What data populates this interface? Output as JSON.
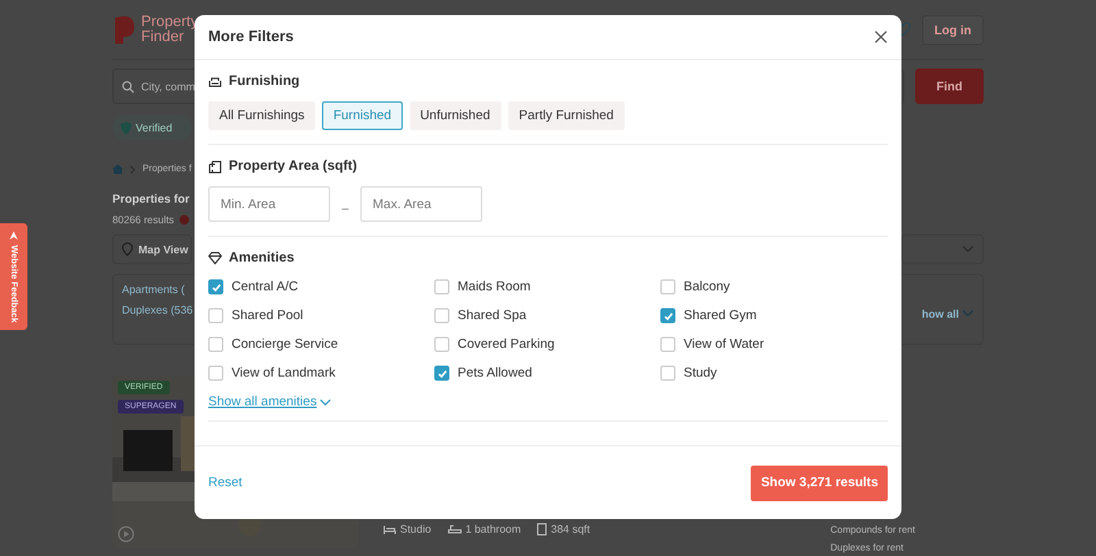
{
  "page": {
    "logo_lines": [
      "Property",
      "Finder"
    ],
    "login": "Log in",
    "search_placeholder": "City, comm",
    "find": "Find",
    "chip": "Verified",
    "breadcrumb": "Properties f",
    "heading": "Properties for",
    "results": "80266 results",
    "map_view": "Map View",
    "links": [
      "Apartments (",
      "Duplexes (536"
    ],
    "show_all": "how all",
    "listing": {
      "badges": [
        {
          "label": "VERIFIED",
          "kind": "verified"
        },
        {
          "label": "SUPERAGEN",
          "kind": "superagent"
        }
      ],
      "facts": [
        {
          "label": "Studio",
          "kind": "bed"
        },
        {
          "label": "1 bathroom",
          "kind": "bath"
        },
        {
          "label": "384 sqft",
          "kind": "area"
        }
      ]
    },
    "side_links": [
      "Compounds for rent",
      "Duplexes for rent"
    ],
    "feedback": "Website Feedback"
  },
  "modal": {
    "title": "More Filters",
    "furnishing": {
      "title": "Furnishing",
      "options": [
        {
          "label": "All Furnishings",
          "selected": false
        },
        {
          "label": "Furnished",
          "selected": true
        },
        {
          "label": "Unfurnished",
          "selected": false
        },
        {
          "label": "Partly Furnished",
          "selected": false
        }
      ]
    },
    "area": {
      "title": "Property Area (sqft)",
      "min_placeholder": "Min. Area",
      "separator": "–",
      "max_placeholder": "Max. Area"
    },
    "amenities": {
      "title": "Amenities",
      "items": [
        {
          "label": "Central A/C",
          "checked": true
        },
        {
          "label": "Maids Room",
          "checked": false
        },
        {
          "label": "Balcony",
          "checked": false
        },
        {
          "label": "Shared Pool",
          "checked": false
        },
        {
          "label": "Shared Spa",
          "checked": false
        },
        {
          "label": "Shared Gym",
          "checked": true
        },
        {
          "label": "Concierge Service",
          "checked": false
        },
        {
          "label": "Covered Parking",
          "checked": false
        },
        {
          "label": "View of Water",
          "checked": false
        },
        {
          "label": "View of Landmark",
          "checked": false
        },
        {
          "label": "Pets Allowed",
          "checked": true
        },
        {
          "label": "Study",
          "checked": false
        }
      ],
      "show_all": "Show all amenities"
    },
    "reset": "Reset",
    "submit": "Show 3,271 results"
  }
}
